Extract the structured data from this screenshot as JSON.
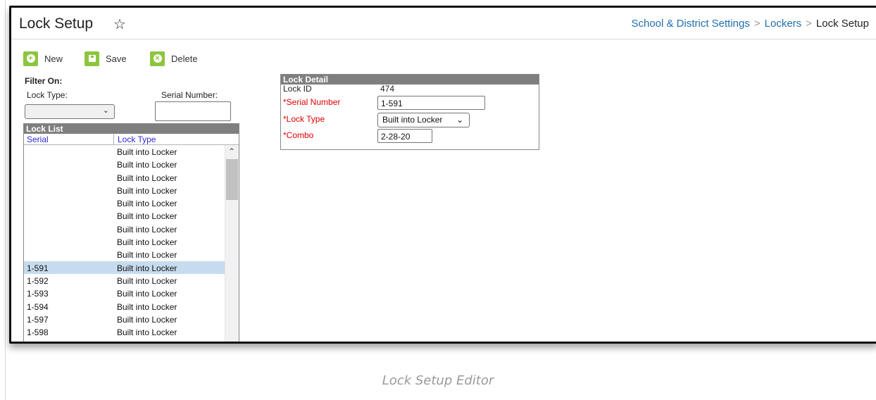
{
  "header": {
    "title": "Lock Setup",
    "star_icon": "star-outline-icon",
    "breadcrumb": [
      "School & District Settings",
      "Lockers",
      "Lock Setup"
    ]
  },
  "toolbar": {
    "new_label": "New",
    "save_label": "Save",
    "delete_label": "Delete",
    "accent_color": "#8cc63f"
  },
  "filter": {
    "heading": "Filter On:",
    "lock_type_label": "Lock Type:",
    "lock_type_value": "",
    "serial_label": "Serial Number:",
    "serial_value": ""
  },
  "lock_list": {
    "title": "Lock List",
    "columns": [
      "Serial",
      "Lock Type"
    ],
    "rows": [
      {
        "serial": "",
        "type": "Built into Locker"
      },
      {
        "serial": "",
        "type": "Built into Locker"
      },
      {
        "serial": "",
        "type": "Built into Locker"
      },
      {
        "serial": "",
        "type": "Built into Locker"
      },
      {
        "serial": "",
        "type": "Built into Locker"
      },
      {
        "serial": "",
        "type": "Built into Locker"
      },
      {
        "serial": "",
        "type": "Built into Locker"
      },
      {
        "serial": "",
        "type": "Built into Locker"
      },
      {
        "serial": "",
        "type": "Built into Locker"
      },
      {
        "serial": "1-591",
        "type": "Built into Locker"
      },
      {
        "serial": "1-592",
        "type": "Built into Locker"
      },
      {
        "serial": "1-593",
        "type": "Built into Locker"
      },
      {
        "serial": "1-594",
        "type": "Built into Locker"
      },
      {
        "serial": "1-597",
        "type": "Built into Locker"
      },
      {
        "serial": "1-598",
        "type": "Built into Locker"
      }
    ],
    "selected_serial": "1-591"
  },
  "lock_detail": {
    "title": "Lock Detail",
    "lock_id_label": "Lock ID",
    "lock_id_value": "474",
    "required_marker": "*",
    "serial_label": "Serial Number",
    "serial_value": "1-591",
    "type_label": "Lock Type",
    "type_value": "Built into Locker",
    "combo_label": "Combo",
    "combo_value": "2-28-20"
  },
  "caption": "Lock Setup Editor"
}
